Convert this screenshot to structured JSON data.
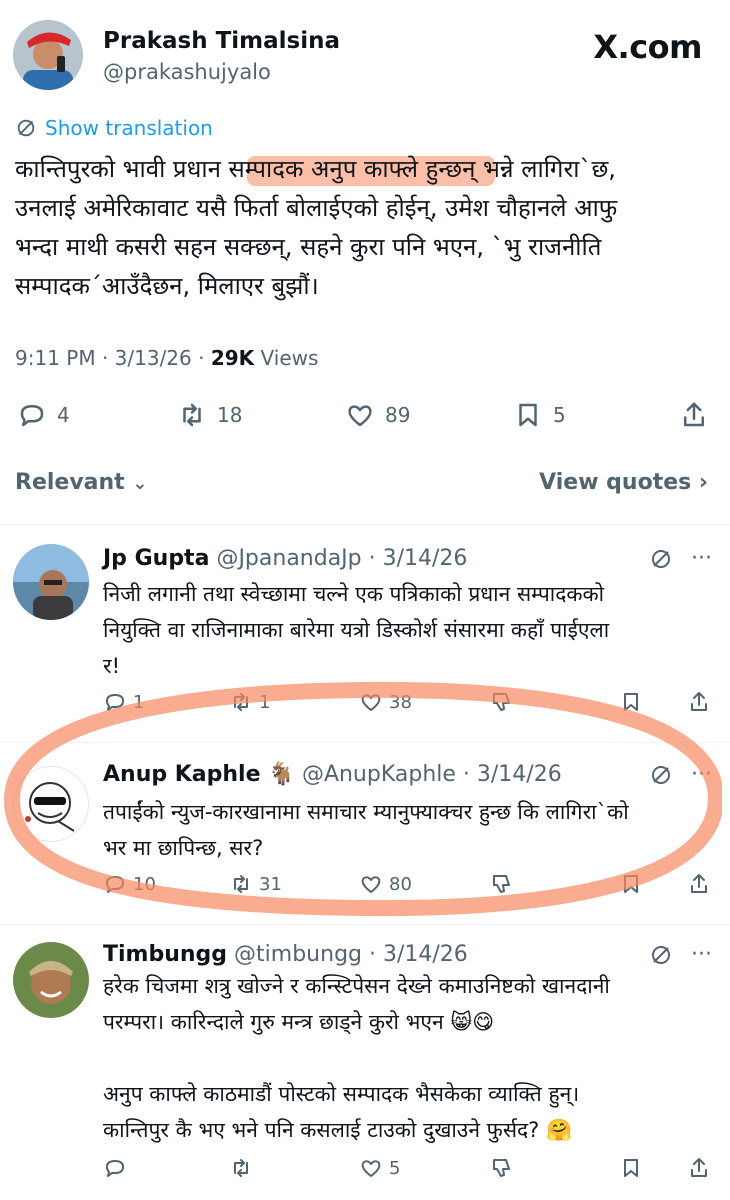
{
  "author": {
    "name": "Prakash Timalsina",
    "handle": "@prakashujyalo"
  },
  "site_label": "X.com",
  "translation_label": "Show translation",
  "tweet": {
    "text": "कान्तिपुरको भावी प्रधान सम्पादक अनुप काफ्ले हुन्छन् भन्ने लागिरा`छ,\nउनलाई अमेरिकावाट यसै फिर्ता बोलाईएको होईन्, उमेश चौहानले आफु\nभन्दा माथी कसरी सहन सक्छन्, सहने कुरा पनि भएन, `भु राजनीति\nसम्पादक´आउँदैछन, मिलाएर बुझौं।",
    "time": "9:11 PM · 3/13/26 · ",
    "views_count": "29K",
    "views_label": " Views",
    "stats": {
      "replies": "4",
      "reposts": "18",
      "likes": "89",
      "bookmarks": "5"
    }
  },
  "sort": {
    "label": "Relevant",
    "view_quotes": "View quotes"
  },
  "replies": [
    {
      "name": "Jp Gupta",
      "handle": "@JpanandaJp · 3/14/26",
      "text": "निजी लगानी तथा स्वेच्छामा चल्ने एक पत्रिकाको प्रधान सम्पादकको\nनियुक्ति वा राजिनामाका बारेमा यत्रो डिस्कोर्श संसारमा कहाँ पाईएला\nर!",
      "replies": "1",
      "reposts": "1",
      "likes": "38"
    },
    {
      "name": "Anup Kaphle",
      "badge": "🐐",
      "handle": "@AnupKaphle · 3/14/26",
      "text": "तपाईंको न्युज-कारखानामा समाचार म्यानुफ्याक्चर हुन्छ कि लागिरा`को\nभर मा छापिन्छ, सर?",
      "replies": "10",
      "reposts": "31",
      "likes": "80"
    },
    {
      "name": "Timbungg",
      "handle": "@timbungg · 3/14/26",
      "text": "हरेक चिजमा शत्रु खोज्ने र कन्स्टिपेसन देख्ने कमाउनिष्टको खानदानी\nपरम्परा। कारिन्दाले गुरु मन्त्र छाड्ने कुरो भएन 😸😋\n\nअनुप काफ्ले काठमाडौं पोस्टको सम्पादक भैसकेका व्याक्ति हुन्।\nकान्तिपुर कै भए भने पनि कसलाई टाउको दुखाउने फुर्सद? 🤗",
      "replies": "",
      "reposts": "",
      "likes": "5"
    }
  ],
  "more_label": "···",
  "colors": {
    "accent": "#1d9bf0",
    "highlight": "#f78960",
    "muted": "#536471"
  }
}
